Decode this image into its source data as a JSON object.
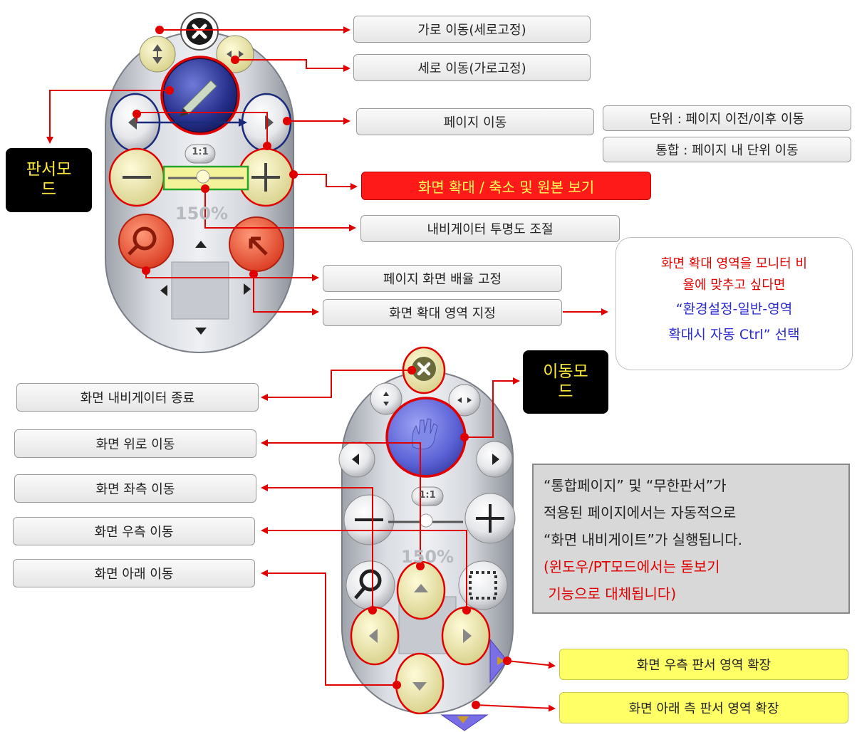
{
  "labels": {
    "h_move": "가로 이동(세로고정)",
    "v_move": "세로 이동(가로고정)",
    "page_move": "페이지 이동",
    "unit_mode": "단위 : 페이지 이전/이후 이동",
    "integrated_mode": "통합 : 페이지 내 단위 이동",
    "zoom": "화면 확대 / 축소 및 원본 보기",
    "opacity": "내비게이터 투명도 조절",
    "fix_ratio": "페이지 화면 배율 고정",
    "zoom_area": "화면 확대 영역 지정",
    "nav_exit": "화면 내비게이터 종료",
    "move_up": "화면 위로 이동",
    "move_left": "화면 좌측 이동",
    "move_right": "화면 우측 이동",
    "move_down": "화면 아래 이동",
    "extend_right": "화면 우측 판서 영역 확장",
    "extend_down": "화면 아래 측 판서 영역 확장"
  },
  "modes": {
    "writing_mode": "판서모드",
    "move_mode": "이동모드"
  },
  "callout": {
    "line1": "화면 확대 영역을 모니터 비",
    "line2": "율에 맞추고 싶다면",
    "line3": "“환경설정-일반-영역",
    "line4": "확대시 자동 Ctrl” 선택"
  },
  "note": {
    "line1": "“통합페이지” 및 “무한판서”가",
    "line2": "적용된 페이지에서는 자동적으로",
    "line3": "“화면 내비게이트”가 실행됩니다.",
    "line4": "(윈도우/PT모드에서는 돋보기",
    "line5": " 기능으로 대체됩니다)"
  },
  "navigator": {
    "zoom_level": "150%",
    "one_to_one": "1:1"
  },
  "colors": {
    "arrow_red": "#e00000",
    "highlight_yellow": "#ffff66",
    "zoom_banner": "#ff1a1a",
    "navy": "#1a2a7a"
  }
}
